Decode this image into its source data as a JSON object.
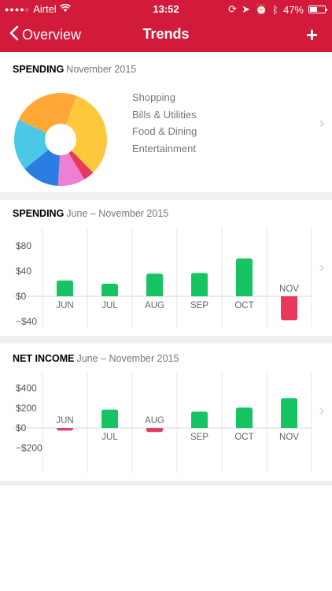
{
  "status": {
    "carrier": "Airtel",
    "time": "13:52",
    "battery": "47%"
  },
  "nav": {
    "back_label": "Overview",
    "title": "Trends",
    "add_glyph": "+"
  },
  "spending_pie": {
    "title": "SPENDING",
    "period": "November 2015",
    "legend": [
      "Shopping",
      "Bills & Utilities",
      "Food & Dining",
      "Entertainment"
    ],
    "colors": [
      "#ffc83d",
      "#e8395c",
      "#ee7fd4",
      "#2a7ee0",
      "#4bc8e8",
      "#ffa838"
    ],
    "chart_data": {
      "type": "pie",
      "values": [
        34,
        4,
        10,
        14,
        19,
        25
      ],
      "colors": [
        "#ffc83d",
        "#e8395c",
        "#ee7fd4",
        "#2a7ee0",
        "#4bc8e8",
        "#ffa838"
      ]
    }
  },
  "spending_bar": {
    "title": "SPENDING",
    "period": "June – November 2015",
    "yticks": [
      "$80",
      "$40",
      "$0",
      "−$40"
    ],
    "chart_data": {
      "type": "bar",
      "categories": [
        "JUN",
        "JUL",
        "AUG",
        "SEP",
        "OCT",
        "NOV"
      ],
      "values": [
        25,
        20,
        36,
        37,
        60,
        -38
      ],
      "ylim": [
        -50,
        100
      ],
      "yticks": [
        80,
        40,
        0,
        -40
      ],
      "colors": {
        "positive": "#17c464",
        "negative": "#e8395c"
      }
    }
  },
  "net_income_bar": {
    "title": "NET INCOME",
    "period": "June – November 2015",
    "yticks": [
      "$400",
      "$200",
      "$0",
      "−$200"
    ],
    "chart_data": {
      "type": "bar",
      "categories": [
        "JUN",
        "JUL",
        "AUG",
        "SEP",
        "OCT",
        "NOV"
      ],
      "values": [
        -25,
        185,
        -40,
        165,
        205,
        300
      ],
      "ylim": [
        -450,
        500
      ],
      "yticks": [
        400,
        200,
        0,
        -200
      ],
      "colors": {
        "positive": "#17c464",
        "negative": "#e8395c"
      }
    }
  }
}
